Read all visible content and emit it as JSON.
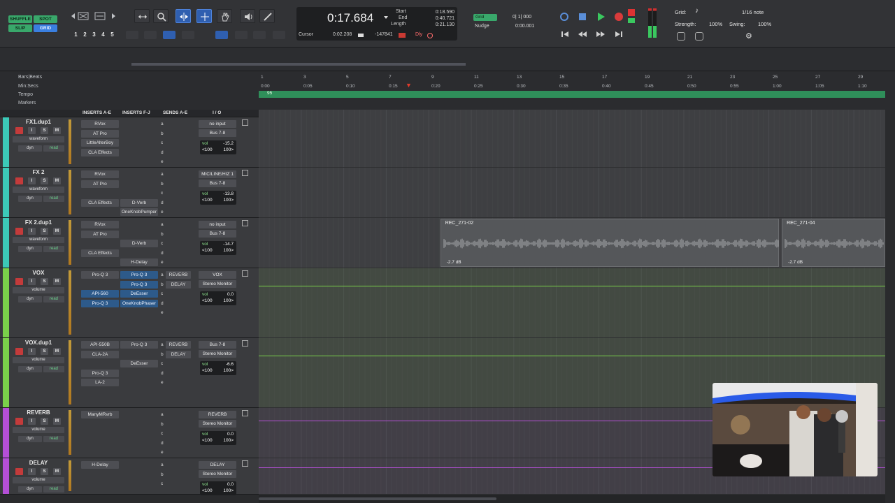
{
  "modes": {
    "shuffle": "SHUFFLE",
    "spot": "SPOT",
    "slip": "SLIP",
    "grid": "GRID"
  },
  "zoom_presets": [
    "1",
    "2",
    "3",
    "4",
    "5"
  ],
  "counter": {
    "main": "0:17.684",
    "start_label": "Start",
    "start": "0:18.590",
    "end_label": "End",
    "end": "0:40.721",
    "length_label": "Length",
    "length": "0:21.130",
    "cursor_label": "Cursor",
    "cursor": "0:02.208",
    "sample": "-147841",
    "dly_label": "Dly"
  },
  "grid_nudge": {
    "grid_label": "Grid",
    "grid_value": "0| 1| 000",
    "nudge_label": "Nudge",
    "nudge_value": "0:00.001"
  },
  "grid_panel": {
    "grid_label": "Grid:",
    "grid_value": "1/16 note",
    "strength_label": "Strength:",
    "strength": "100%",
    "swing_label": "Swing:",
    "swing": "100%"
  },
  "rulers": {
    "labels": [
      "Bars|Beats",
      "Min:Secs",
      "Tempo",
      "Markers"
    ],
    "bars": [
      "1",
      "3",
      "5",
      "7",
      "9",
      "11",
      "13",
      "15",
      "17",
      "19",
      "21",
      "23",
      "25",
      "27",
      "29"
    ],
    "secs": [
      "0:00",
      "0:05",
      "0:10",
      "0:15",
      "0:20",
      "0:25",
      "0:30",
      "0:35",
      "0:40",
      "0:45",
      "0:50",
      "0:55",
      "1:00",
      "1:05",
      "1:10"
    ],
    "tempo": "95"
  },
  "columns": {
    "inserts_ae": "INSERTS A-E",
    "inserts_fj": "INSERTS F-J",
    "sends_ae": "SENDS A-E",
    "io": "I / O"
  },
  "record_buttons": {
    "input": "I",
    "solo": "S",
    "mute": "M"
  },
  "tracks": [
    {
      "name": "FX1.dup1",
      "color": "#3cc9b8",
      "view": "waveform",
      "auto": "read",
      "dyn": "dyn",
      "ins_ae": [
        "RVox",
        "AT Pro",
        "LittleAlterBoy",
        "CLA Effects"
      ],
      "ins_fj": [],
      "sends": [
        "a",
        "b",
        "c",
        "d",
        "e"
      ],
      "send_names": [],
      "io_in": "no input",
      "io_out": "Bus 7-8",
      "vol": "-15.2",
      "pan_l": "<100",
      "pan_r": "100>"
    },
    {
      "name": "FX 2",
      "color": "#3cc9b8",
      "view": "waveform",
      "auto": "read",
      "dyn": "dyn",
      "ins_ae": [
        "RVox",
        "AT Pro",
        "",
        "CLA Effects"
      ],
      "ins_fj": [
        "",
        "",
        "",
        "D-Verb",
        "OneKnobPumper"
      ],
      "sends": [
        "a",
        "b",
        "c",
        "d",
        "e"
      ],
      "send_names": [],
      "io_in": "MIC/LINE/HIZ 1",
      "io_out": "Bus 7-8",
      "vol": "-13.8",
      "pan_l": "<100",
      "pan_r": "100>"
    },
    {
      "name": "FX 2.dup1",
      "color": "#3cc9b8",
      "view": "waveform",
      "auto": "read",
      "dyn": "dyn",
      "ins_ae": [
        "RVox",
        "AT Pro",
        "",
        "CLA Effects"
      ],
      "ins_fj": [
        "",
        "",
        "D-Verb",
        "",
        "H-Delay"
      ],
      "sends": [
        "a",
        "b",
        "c",
        "d",
        "e"
      ],
      "send_names": [],
      "io_in": "no input",
      "io_out": "Bus 7-8",
      "vol": "-14.7",
      "pan_l": "<100",
      "pan_r": "100>",
      "clips": [
        {
          "name": "REC_271-02",
          "gain": "-2.7 dB",
          "start_s": 20.5,
          "end_s": 60.3
        },
        {
          "name": "REC_271-04",
          "gain": "-2.7 dB",
          "start_s": 60.6,
          "end_s": 73.5
        }
      ]
    },
    {
      "name": "VOX",
      "color": "#7ad14a",
      "view": "volume",
      "auto": "read",
      "dyn": "dyn",
      "ins_ae": [
        "Pro-Q 3",
        "",
        "API-560",
        "Pro-Q 3"
      ],
      "ins_fj": [
        "Pro-Q 3",
        "Pro-Q 3",
        "DeEsser",
        "OneKnobPhaser"
      ],
      "sends": [
        "a",
        "b",
        "c",
        "d",
        "e"
      ],
      "send_names": [
        "REVERB",
        "DELAY"
      ],
      "io_in": "VOX",
      "io_out": "Stereo Monitor",
      "vol": "0.0",
      "pan_l": "<100",
      "pan_r": "100>"
    },
    {
      "name": "VOX.dup1",
      "color": "#7ad14a",
      "view": "volume",
      "auto": "read",
      "dyn": "dyn",
      "ins_ae": [
        "API-550B",
        "CLA-2A",
        "",
        "Pro-Q 3",
        "LA-2"
      ],
      "ins_fj": [
        "Pro-Q 3",
        "",
        "DeEsser"
      ],
      "sends": [
        "a",
        "b",
        "c",
        "d",
        "e"
      ],
      "send_names": [
        "REVERB",
        "DELAY"
      ],
      "io_in": "Bus 7-8",
      "io_out": "Stereo Monitor",
      "vol": "-6.6",
      "pan_l": "<100",
      "pan_r": "100>"
    },
    {
      "name": "REVERB",
      "color": "#b44fd6",
      "view": "volume",
      "auto": "read",
      "dyn": "dyn",
      "ins_ae": [
        "ManyMRvrb"
      ],
      "ins_fj": [],
      "sends": [
        "a",
        "b",
        "c",
        "d",
        "e"
      ],
      "send_names": [],
      "io_in": "REVERB",
      "io_out": "Stereo Monitor",
      "vol": "0.0",
      "pan_l": "<100",
      "pan_r": "100>"
    },
    {
      "name": "DELAY",
      "color": "#b44fd6",
      "view": "volume",
      "auto": "read",
      "dyn": "dyn",
      "ins_ae": [
        "H-Delay"
      ],
      "ins_fj": [],
      "sends": [
        "a",
        "b",
        "c",
        "d",
        "e"
      ],
      "send_names": [],
      "io_in": "DELAY",
      "io_out": "Stereo Monitor",
      "vol": "0.0",
      "pan_l": "<100",
      "pan_r": "100>"
    }
  ],
  "colors": {
    "teal": "#3cc9b8",
    "green": "#7ad14a",
    "purple": "#b44fd6",
    "accent_blue": "#2f5fb0",
    "tempo_green": "#2f8f5a",
    "playhead": "#e23a2a"
  }
}
